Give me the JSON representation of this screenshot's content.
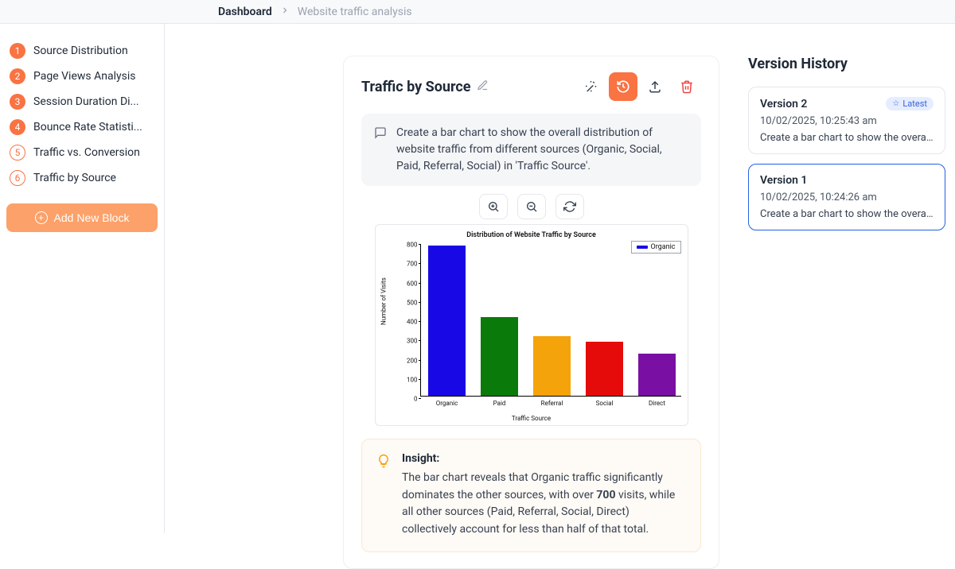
{
  "breadcrumb": {
    "root": "Dashboard",
    "page": "Website traffic analysis"
  },
  "sidebar": {
    "items": [
      {
        "num": "1",
        "label": "Source Distribution",
        "outline": false
      },
      {
        "num": "2",
        "label": "Page Views Analysis",
        "outline": false
      },
      {
        "num": "3",
        "label": "Session Duration Di...",
        "outline": false
      },
      {
        "num": "4",
        "label": "Bounce Rate Statisti...",
        "outline": false
      },
      {
        "num": "5",
        "label": "Traffic vs. Conversion",
        "outline": true
      },
      {
        "num": "6",
        "label": "Traffic by Source",
        "outline": true
      }
    ],
    "add_label": "Add New Block"
  },
  "block": {
    "title": "Traffic by Source",
    "prompt": "Create a bar chart to show the overall distribution of website traffic from different sources (Organic, Social, Paid, Referral, Social) in 'Traffic Source'.",
    "insight_label": "Insight:",
    "insight_text_pre": "The bar chart reveals that Organic traffic significantly dominates the other sources, with over ",
    "insight_strong": "700",
    "insight_text_post": " visits, while all other sources (Paid, Referral, Social, Direct) collectively account for less than half of that total."
  },
  "version_history": {
    "title": "Version History",
    "latest_label": "Latest",
    "versions": [
      {
        "name": "Version 2",
        "date": "10/02/2025, 10:25:43 am",
        "desc": "Create a bar chart to show the overall...",
        "latest": true,
        "selected": false
      },
      {
        "name": "Version 1",
        "date": "10/02/2025, 10:24:26 am",
        "desc": "Create a bar chart to show the overal...",
        "latest": false,
        "selected": true
      }
    ]
  },
  "chart_data": {
    "type": "bar",
    "title": "Distribution of Website Traffic by Source",
    "xlabel": "Traffic Source",
    "ylabel": "Number of Visits",
    "ylim": [
      0,
      800
    ],
    "yticks": [
      0,
      100,
      200,
      300,
      400,
      500,
      600,
      700,
      800
    ],
    "legend": [
      "Organic"
    ],
    "categories": [
      "Organic",
      "Paid",
      "Referral",
      "Social",
      "Direct"
    ],
    "values": [
      780,
      410,
      310,
      280,
      220
    ],
    "colors": [
      "#1908e6",
      "#0a7b0a",
      "#f5a30a",
      "#e60b0b",
      "#7a0fa3"
    ]
  }
}
